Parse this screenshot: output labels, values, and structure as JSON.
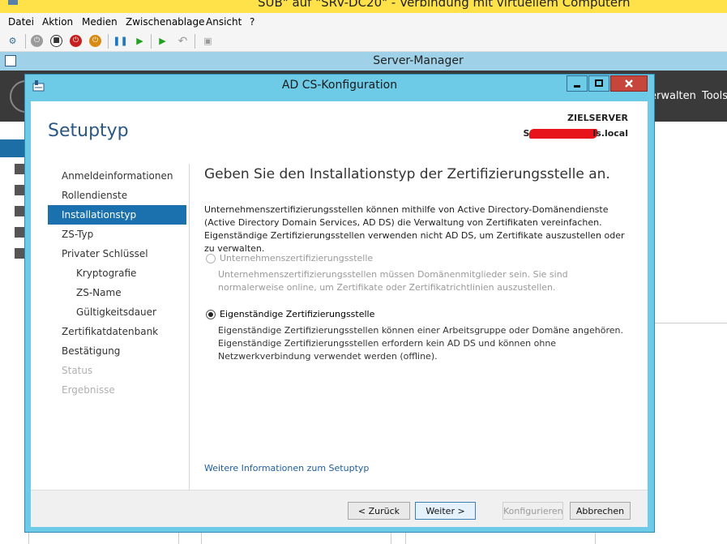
{
  "vm": {
    "title": "SUB\" auf \"SRV-DC20\" - Verbindung mit virtuellem Computern",
    "menu": [
      "Datei",
      "Aktion",
      "Medien",
      "Zwischenablage",
      "Ansicht",
      "?"
    ]
  },
  "server_manager": {
    "title": "Server-Manager",
    "header_items": [
      "erwalten",
      "Tools"
    ]
  },
  "dialog": {
    "title": "AD CS-Konfiguration",
    "setup_title": "Setuptyp",
    "target_label": "ZIELSERVER",
    "target_value_prefix": "S",
    "target_value_suffix": "ls.local",
    "nav": [
      "Anmeldeinformationen",
      "Rollendienste",
      "Installationstyp",
      "ZS-Typ",
      "Privater Schlüssel",
      "Kryptografie",
      "ZS-Name",
      "Gültigkeitsdauer",
      "Zertifikatdatenbank",
      "Bestätigung",
      "Status",
      "Ergebnisse"
    ],
    "heading": "Geben Sie den Installationstyp der Zertifizierungsstelle an.",
    "description": "Unternehmenszertifizierungsstellen können mithilfe von Active Directory-Domänendienste (Active Directory Domain Services, AD DS) die Verwaltung von Zertifikaten vereinfachen. Eigenständige Zertifizierungsstellen verwenden nicht AD DS, um Zertifikate auszustellen oder zu verwalten.",
    "option_enterprise": {
      "label": "Unternehmenszertifizierungsstelle",
      "description": "Unternehmenszertifizierungsstellen müssen Domänenmitglieder sein. Sie sind normalerweise online, um Zertifikate oder Zertifikatrichtlinien auszustellen."
    },
    "option_standalone": {
      "label": "Eigenständige Zertifizierungsstelle",
      "description": "Eigenständige Zertifizierungsstellen können einer Arbeitsgruppe oder Domäne angehören. Eigenständige Zertifizierungsstellen erfordern kein AD DS und können ohne Netzwerkverbindung verwendet werden (offline)."
    },
    "more_info": "Weitere Informationen zum Setuptyp",
    "buttons": {
      "back": "< Zurück",
      "next": "Weiter >",
      "configure": "Konfigurieren",
      "cancel": "Abbrechen"
    }
  }
}
